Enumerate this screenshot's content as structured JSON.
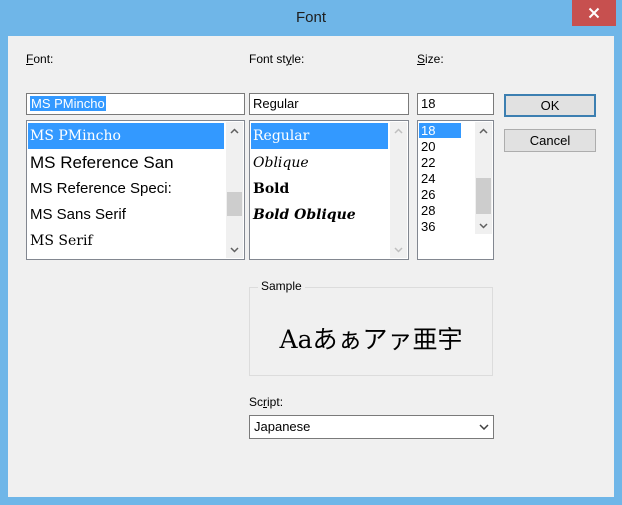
{
  "window": {
    "title": "Font"
  },
  "font": {
    "label_underline": "F",
    "label_rest": "ont:",
    "value": "MS PMincho",
    "items": [
      "MS PMincho",
      "MS Reference San",
      "MS Reference Speci:",
      "MS Sans Serif",
      "MS Serif"
    ],
    "selected_index": 0
  },
  "style": {
    "label_pre": "Font st",
    "label_underline": "y",
    "label_post": "le:",
    "value": "Regular",
    "items": [
      "Regular",
      "Oblique",
      "Bold",
      "Bold Oblique"
    ],
    "selected_index": 0
  },
  "size": {
    "label_underline": "S",
    "label_rest": "ize:",
    "value": "18",
    "items": [
      "18",
      "20",
      "22",
      "24",
      "26",
      "28",
      "36"
    ],
    "selected_index": 0
  },
  "buttons": {
    "ok": "OK",
    "cancel": "Cancel"
  },
  "sample": {
    "label": "Sample",
    "text": "Aaあぁアァ亜宇"
  },
  "script": {
    "label_pre": "Sc",
    "label_underline": "r",
    "label_post": "ipt:",
    "value": "Japanese"
  },
  "icons": {
    "close": "close-icon",
    "scroll_up": "chevron-up-icon",
    "scroll_down": "chevron-down-icon",
    "dropdown": "chevron-down-icon"
  },
  "colors": {
    "titlebar": "#6fb6e8",
    "close_button": "#c7504f",
    "selection": "#3399ff",
    "dialog_bg": "#f0f0f0"
  }
}
